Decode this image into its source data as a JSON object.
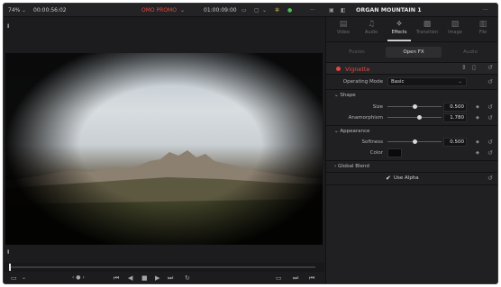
{
  "topbar": {
    "zoom": "74%",
    "zoom_caret": "⌄",
    "timecode_left": "00:00:56:02",
    "timeline_name": "OMO PROMO",
    "timeline_caret": "⌄",
    "timecode_right": "01:00:09:00",
    "clip_name": "ORGAN MOUNTAIN 1"
  },
  "icons": {
    "dual_viewer": "▭",
    "view_options": "▢",
    "view_caret": "⌄",
    "color_wand": "✲",
    "dot_green": "●",
    "more": "···",
    "inspector_toggle": "▣",
    "split": "◧",
    "more2": "···"
  },
  "inspector": {
    "tabs": [
      {
        "label": "Video",
        "icon": "▤"
      },
      {
        "label": "Audio",
        "icon": "♫"
      },
      {
        "label": "Effects",
        "icon": "✧"
      },
      {
        "label": "Transition",
        "icon": "▩"
      },
      {
        "label": "Image",
        "icon": "▨"
      },
      {
        "label": "File",
        "icon": "▥"
      }
    ],
    "subtabs": [
      "Fusion",
      "Open FX",
      "Audio"
    ],
    "effect": {
      "name": "Vignette",
      "operating_mode_label": "Operating Mode",
      "operating_mode_value": "Basic",
      "shape_section": "Shape",
      "size_label": "Size",
      "size_value": "0.500",
      "size_fraction": 0.5,
      "anamorphism_label": "Anamorphism",
      "anamorphism_value": "1.780",
      "anamorphism_fraction": 0.59,
      "appearance_section": "Appearance",
      "softness_label": "Softness",
      "softness_value": "0.500",
      "softness_fraction": 0.5,
      "color_label": "Color",
      "global_blend_section": "Global Blend",
      "use_alpha_label": "Use Alpha"
    }
  },
  "viewer": {
    "in_marker": "I",
    "out_marker": "I"
  },
  "transport": {
    "safe_area": "▭",
    "safe_caret": "⌄",
    "jog": "‹ ● ›",
    "first": "⏮",
    "reverse": "◀",
    "stop": "■",
    "play": "▶",
    "last": "⏭",
    "loop": "↻",
    "match": "▭",
    "next_mark": "⏭",
    "end": "⏮"
  },
  "colors": {
    "accent_red": "#e2473f"
  }
}
